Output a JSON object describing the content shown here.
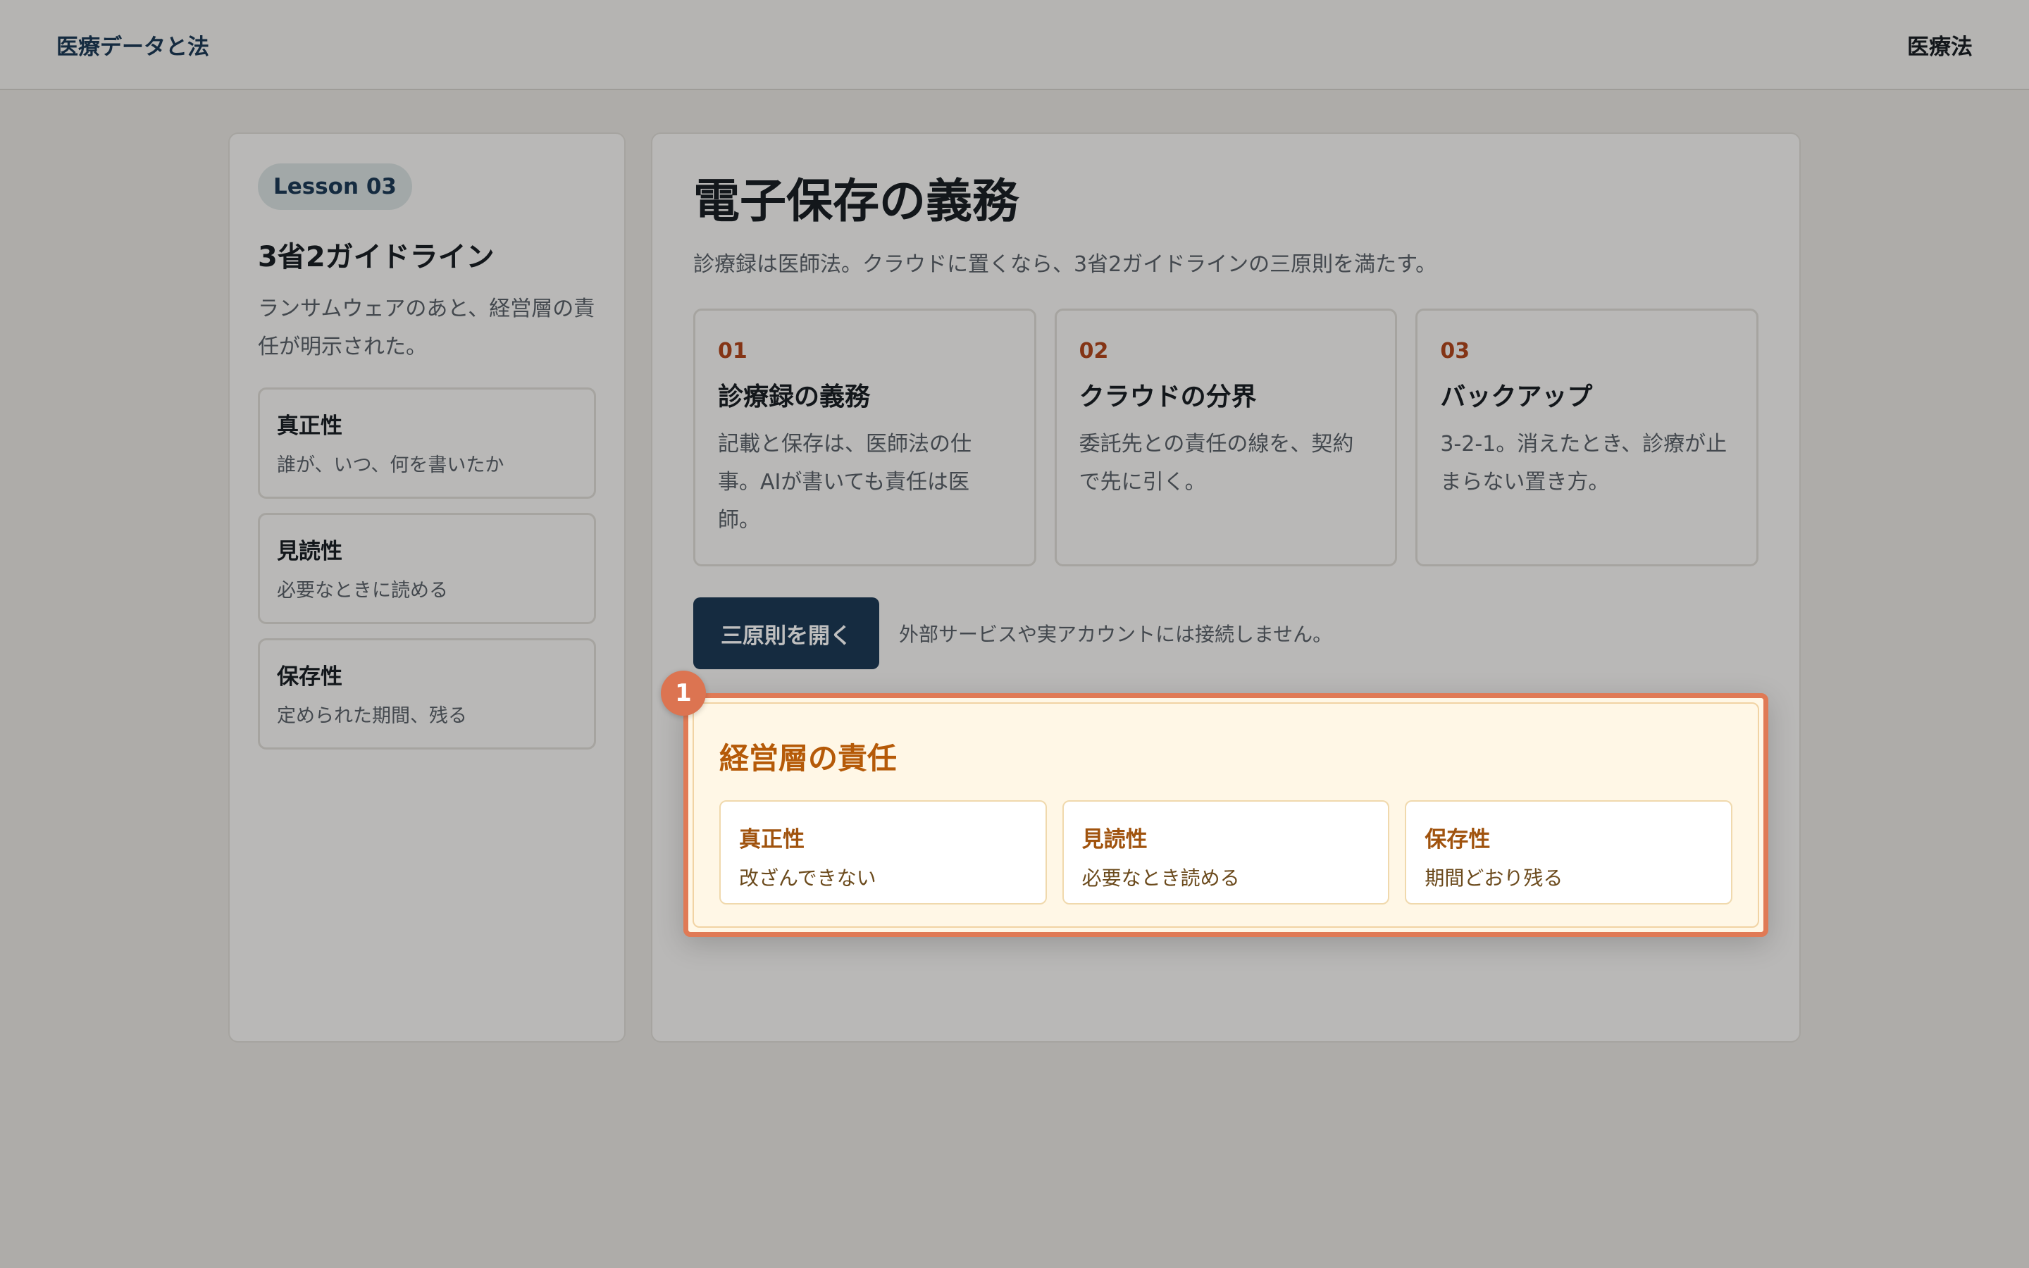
{
  "header": {
    "brand": "医療データと法",
    "nav_item": "医療法"
  },
  "sidebar": {
    "lesson_tag": "Lesson 03",
    "title": "3省2ガイドライン",
    "description": "ランサムウェアのあと、経営層の責任が明示された。",
    "principles": [
      {
        "title": "真正性",
        "desc": "誰が、いつ、何を書いたか"
      },
      {
        "title": "見読性",
        "desc": "必要なときに読める"
      },
      {
        "title": "保存性",
        "desc": "定められた期間、残る"
      }
    ]
  },
  "main": {
    "title": "電子保存の義務",
    "subtitle": "診療録は医師法。クラウドに置くなら、3省2ガイドラインの三原則を満たす。",
    "cards": [
      {
        "num": "01",
        "title": "診療録の義務",
        "desc": "記載と保存は、医師法の仕事。AIが書いても責任は医師。"
      },
      {
        "num": "02",
        "title": "クラウドの分界",
        "desc": "委託先との責任の線を、契約で先に引く。"
      },
      {
        "num": "03",
        "title": "バックアップ",
        "desc": "3-2-1。消えたとき、診療が止まらない置き方。"
      }
    ],
    "button_label": "三原則を開く",
    "button_note": "外部サービスや実アカウントには接続しません。"
  },
  "highlight": {
    "step": "1",
    "title": "経営層の責任",
    "items": [
      {
        "name": "真正性",
        "desc": "改ざんできない"
      },
      {
        "name": "見読性",
        "desc": "必要なとき読める"
      },
      {
        "name": "保存性",
        "desc": "期間どおり残る"
      }
    ]
  },
  "colors": {
    "primary": "#1d3a56",
    "accent": "#b0461d",
    "highlight_border": "#e07a55",
    "highlight_bg": "#fff7e6"
  }
}
